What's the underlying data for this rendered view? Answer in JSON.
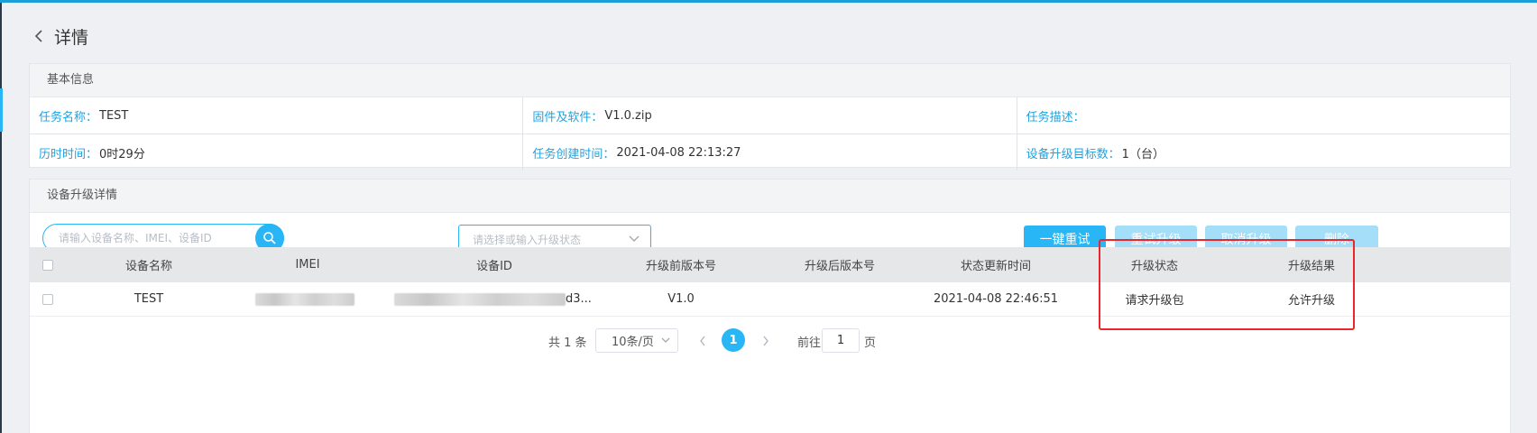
{
  "header": {
    "title": "详情"
  },
  "basic_info": {
    "title": "基本信息",
    "rows": [
      [
        {
          "label": "任务名称：",
          "value": "TEST"
        },
        {
          "label": "固件及软件：",
          "value": "V1.0.zip"
        },
        {
          "label": "任务描述：",
          "value": ""
        }
      ],
      [
        {
          "label": "历时时间：",
          "value": "0时29分"
        },
        {
          "label": "任务创建时间：",
          "value": "2021-04-08 22:13:27"
        },
        {
          "label": "设备升级目标数：",
          "value": "1（台）"
        }
      ]
    ]
  },
  "device_detail": {
    "title": "设备升级详情",
    "search": {
      "placeholder": "请输入设备名称、IMEI、设备ID",
      "value": ""
    },
    "status_select": {
      "placeholder": "请选择或输入升级状态"
    },
    "buttons": {
      "retry_all": "一键重试",
      "retry_upgrade": "重试升级",
      "cancel_upgrade": "取消升级",
      "delete": "删除"
    },
    "columns": [
      "设备名称",
      "IMEI",
      "设备ID",
      "升级前版本号",
      "升级后版本号",
      "状态更新时间",
      "升级状态",
      "升级结果"
    ],
    "rows": [
      {
        "device_name": "TEST",
        "imei_redacted": true,
        "device_id_suffix": "d3...",
        "version_before": "V1.0",
        "version_after": "",
        "updated_at": "2021-04-08 22:46:51",
        "status": "请求升级包",
        "result": "允许升级"
      }
    ],
    "pagination": {
      "total": "共 1 条",
      "page_size": "10条/页",
      "current": "1",
      "goto_label": "前往",
      "goto_value": "1",
      "goto_unit": "页"
    }
  },
  "colors": {
    "accent": "#29b6f6",
    "accent_disabled": "#a4def8",
    "label_blue": "#1fa3e0",
    "highlight_red": "#e8262b",
    "top_strip": "#1a9fd9"
  }
}
